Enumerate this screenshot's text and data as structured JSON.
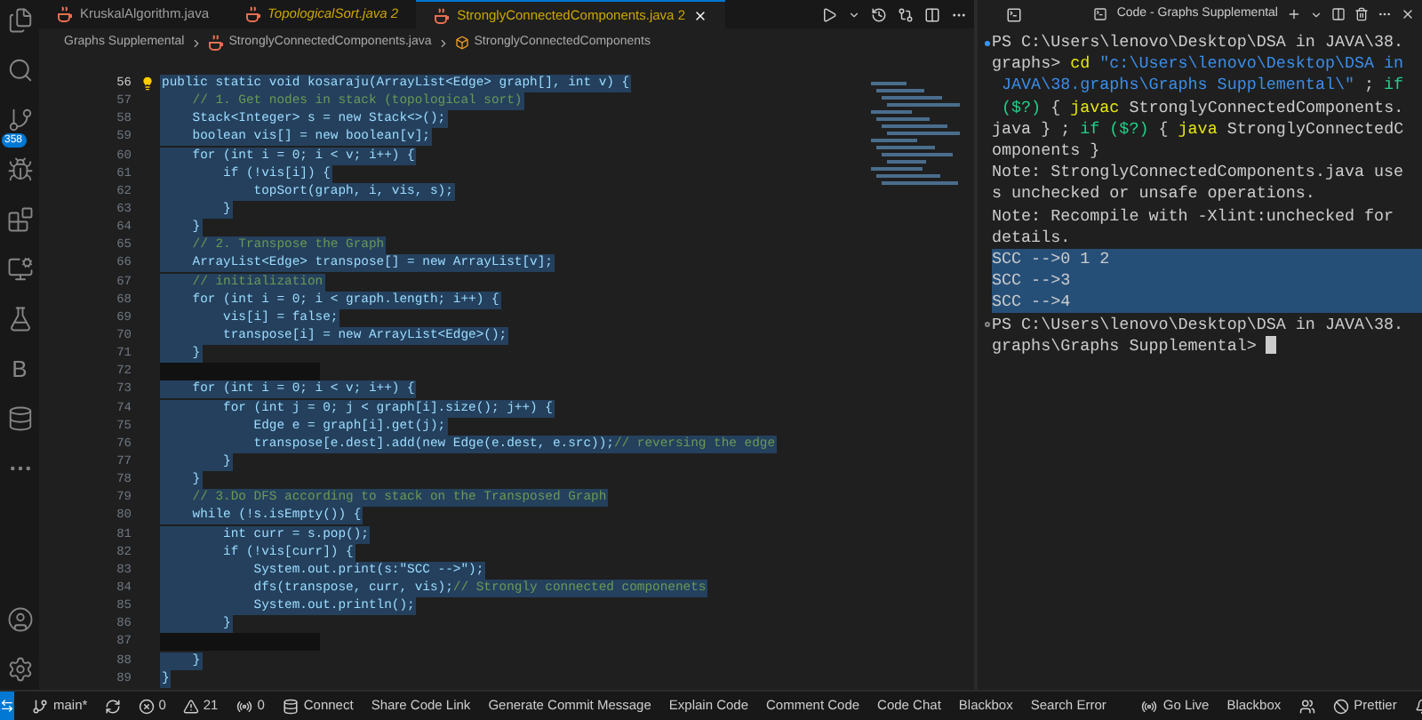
{
  "tabs": [
    {
      "label": "KruskalAlgorithm.java",
      "preview": false,
      "selected": false
    },
    {
      "label": "TopologicalSort.java",
      "badge": "2",
      "preview": true,
      "selected": false
    },
    {
      "label": "StronglyConnectedComponents.java",
      "badge": "2",
      "preview": false,
      "selected": true
    }
  ],
  "breadcrumb": [
    "Graphs Supplemental",
    "StronglyConnectedComponents.java",
    "StronglyConnectedComponents"
  ],
  "activity_badge": "358",
  "activity_letter": "B",
  "code_lines": [
    {
      "n": "56",
      "code": "public static void kosaraju(ArrayList<Edge> graph[], int v) {",
      "selected": true
    },
    {
      "n": "57",
      "comment": "    // 1. Get nodes in stack (topological sort)",
      "selected": true
    },
    {
      "n": "58",
      "code": "    Stack<Integer> s = new Stack<>();",
      "selected": true
    },
    {
      "n": "59",
      "code": "    boolean vis[] = new boolean[v];",
      "selected": true
    },
    {
      "n": "60",
      "code": "    for (int i = 0; i < v; i++) {",
      "selected": true
    },
    {
      "n": "61",
      "code": "        if (!vis[i]) {",
      "selected": true
    },
    {
      "n": "62",
      "code": "            topSort(graph, i, vis, s);",
      "selected": true
    },
    {
      "n": "63",
      "code": "        }",
      "selected": true
    },
    {
      "n": "64",
      "code": "    }",
      "selected": true
    },
    {
      "n": "65",
      "comment": "    // 2. Transpose the Graph",
      "selected": true
    },
    {
      "n": "66",
      "code": "    ArrayList<Edge> transpose[] = new ArrayList[v];",
      "selected": true
    },
    {
      "n": "67",
      "comment": "    // initialization",
      "selected": true
    },
    {
      "n": "68",
      "code": "    for (int i = 0; i < graph.length; i++) {",
      "selected": true
    },
    {
      "n": "69",
      "code": "        vis[i] = false;",
      "selected": true
    },
    {
      "n": "70",
      "code": "        transpose[i] = new ArrayList<Edge>();",
      "selected": true
    },
    {
      "n": "71",
      "code": "    }",
      "selected": true
    },
    {
      "n": "72",
      "selected": false
    },
    {
      "n": "73",
      "code": "    for (int i = 0; i < v; i++) {",
      "selected": true
    },
    {
      "n": "74",
      "code": "        for (int j = 0; j < graph[i].size(); j++) {",
      "selected": true
    },
    {
      "n": "75",
      "code": "            Edge e = graph[i].get(j);",
      "selected": true
    },
    {
      "n": "76",
      "code": "            transpose[e.dest].add(new Edge(e.dest, e.src));",
      "comment": "// reversing the edge",
      "selected": true
    },
    {
      "n": "77",
      "code": "        }",
      "selected": true
    },
    {
      "n": "78",
      "code": "    }",
      "selected": true
    },
    {
      "n": "79",
      "comment": "    // 3.Do DFS according to stack on the Transposed Graph",
      "selected": true
    },
    {
      "n": "80",
      "code": "    while (!s.isEmpty()) {",
      "selected": true
    },
    {
      "n": "81",
      "code": "        int curr = s.pop();",
      "selected": true
    },
    {
      "n": "82",
      "code": "        if (!vis[curr]) {",
      "selected": true
    },
    {
      "n": "83",
      "code": "            System.out.print(s:\"SCC -->\");",
      "selected": true
    },
    {
      "n": "84",
      "code": "            dfs(transpose, curr, vis);",
      "comment": "// Strongly connected componenets",
      "selected": true
    },
    {
      "n": "85",
      "code": "            System.out.println();",
      "selected": true
    },
    {
      "n": "86",
      "code": "        }",
      "selected": true
    },
    {
      "n": "87",
      "selected": false
    },
    {
      "n": "88",
      "code": "    }",
      "selected": true
    },
    {
      "n": "89",
      "code": "}",
      "selected": true
    }
  ],
  "terminal": {
    "title": "Code - Graphs Supplemental",
    "lines": [
      {
        "selected": false,
        "parts": [
          {
            "kind": "plain",
            "t": "PS C:\\Users\\lenovo\\Desktop\\DSA in JAVA\\38."
          }
        ]
      },
      {
        "selected": false,
        "parts": [
          {
            "kind": "plain",
            "t": "graphs> "
          },
          {
            "kind": "cmd",
            "t": "cd"
          },
          {
            "kind": "str",
            "t": " \"c:\\Users\\lenovo\\Desktop\\DSA in"
          }
        ]
      },
      {
        "selected": false,
        "parts": [
          {
            "kind": "str",
            "t": " JAVA\\38.graphs\\Graphs Supplemental\\\""
          },
          {
            "kind": "plain",
            "t": " ; "
          },
          {
            "kind": "kw",
            "t": "if"
          }
        ]
      },
      {
        "selected": false,
        "parts": [
          {
            "kind": "kw",
            "t": " ($?)"
          },
          {
            "kind": "plain",
            "t": " { "
          },
          {
            "kind": "cmd",
            "t": "javac"
          },
          {
            "kind": "plain",
            "t": " StronglyConnectedComponents."
          }
        ]
      },
      {
        "selected": false,
        "parts": [
          {
            "kind": "plain",
            "t": "java } ; "
          },
          {
            "kind": "kw",
            "t": "if ($?)"
          },
          {
            "kind": "plain",
            "t": " { "
          },
          {
            "kind": "cmd",
            "t": "java"
          },
          {
            "kind": "plain",
            "t": " StronglyConnectedC"
          }
        ]
      },
      {
        "selected": false,
        "parts": [
          {
            "kind": "plain",
            "t": "omponents }"
          }
        ]
      },
      {
        "selected": false,
        "parts": [
          {
            "kind": "plain",
            "t": "Note: StronglyConnectedComponents.java use"
          }
        ]
      },
      {
        "selected": false,
        "parts": [
          {
            "kind": "plain",
            "t": "s unchecked or unsafe operations."
          }
        ]
      },
      {
        "selected": false,
        "parts": [
          {
            "kind": "plain",
            "t": "Note: Recompile with -Xlint:unchecked for"
          }
        ]
      },
      {
        "selected": false,
        "parts": [
          {
            "kind": "plain",
            "t": "details."
          }
        ]
      },
      {
        "selected": true,
        "parts": [
          {
            "kind": "plain",
            "t": "SCC -->0 1 2"
          }
        ]
      },
      {
        "selected": true,
        "parts": [
          {
            "kind": "plain",
            "t": "SCC -->3"
          }
        ]
      },
      {
        "selected": true,
        "parts": [
          {
            "kind": "plain",
            "t": "SCC -->4"
          }
        ]
      },
      {
        "selected": false,
        "parts": [
          {
            "kind": "plain",
            "t": "PS C:\\Users\\lenovo\\Desktop\\DSA in JAVA\\38."
          }
        ]
      },
      {
        "selected": false,
        "parts": [
          {
            "kind": "plain",
            "t": "graphs\\Graphs Supplemental> "
          }
        ]
      }
    ]
  },
  "status_left": [
    {
      "kind": "branch",
      "label": "main*"
    },
    {
      "kind": "sync"
    },
    {
      "kind": "errors",
      "label": "0"
    },
    {
      "kind": "warnings",
      "label": "21"
    },
    {
      "kind": "ports",
      "label": "0"
    },
    {
      "kind": "db",
      "label": "Connect"
    },
    {
      "kind": "text",
      "label": "Share Code Link"
    },
    {
      "kind": "text",
      "label": "Generate Commit Message"
    },
    {
      "kind": "text",
      "label": "Explain Code"
    },
    {
      "kind": "text",
      "label": "Comment Code"
    },
    {
      "kind": "text",
      "label": "Code Chat"
    },
    {
      "kind": "text",
      "label": "Blackbox"
    },
    {
      "kind": "text",
      "label": "Search Error"
    }
  ],
  "status_right": [
    {
      "kind": "live",
      "label": "Go Live"
    },
    {
      "kind": "text",
      "label": "Blackbox"
    },
    {
      "kind": "people"
    },
    {
      "kind": "prettier",
      "label": "Prettier"
    },
    {
      "kind": "bell"
    }
  ]
}
